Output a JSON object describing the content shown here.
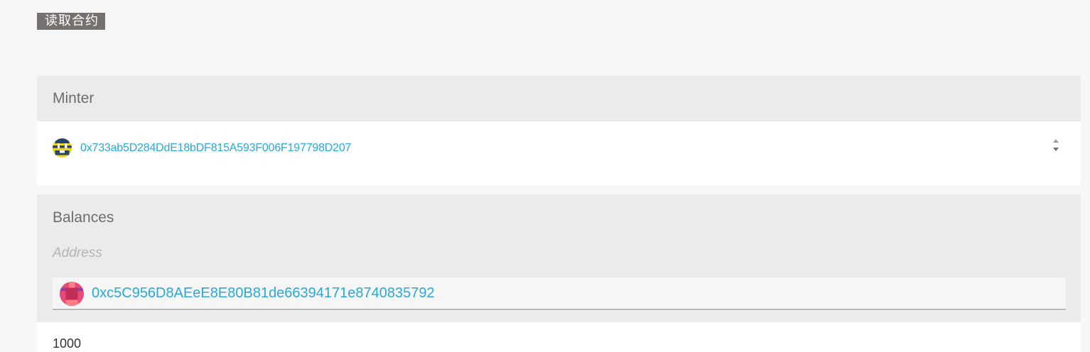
{
  "page": {
    "title_tag": "读取合约"
  },
  "minter": {
    "label": "Minter",
    "value": "0x733ab5D284DdE18bDF815A593F006F197798D207",
    "icon": "identicon-avatar"
  },
  "balances": {
    "label": "Balances",
    "address_label": "Address",
    "address_value": "0xc5C956D8AEeE8E80B81de66394171e8740835792",
    "icon": "identicon-avatar",
    "result": "1000"
  },
  "colors": {
    "link": "#2aa8d6",
    "title_tag_bg": "#76706e"
  }
}
